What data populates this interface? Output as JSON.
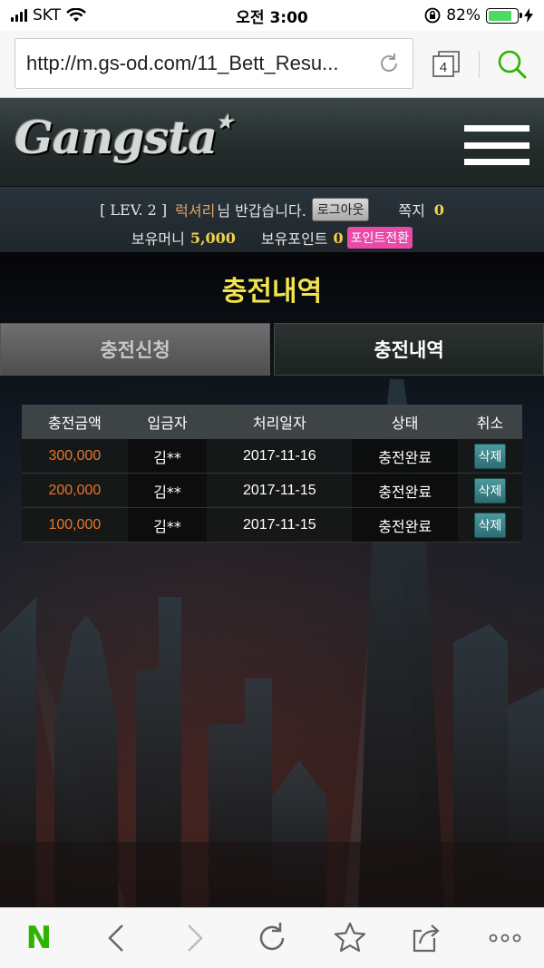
{
  "status_bar": {
    "carrier": "SKT",
    "time": "오전 3:00",
    "battery": "82%",
    "battery_level": 0.82
  },
  "browser": {
    "url": "http://m.gs-od.com/11_Bett_Resu...",
    "tab_count": "4"
  },
  "site": {
    "logo": "Gangsta",
    "logo_star": "★"
  },
  "user": {
    "level": "[ LEV. 2 ]",
    "nickname": "럭셔리",
    "greeting": "님 반갑습니다.",
    "logout_label": "로그아웃",
    "message_label": "쪽지",
    "message_count": "0",
    "money_label": "보유머니",
    "money_value": "5,000",
    "points_label": "보유포인트",
    "points_value": "0",
    "convert_label": "포인트전환"
  },
  "page": {
    "title": "충전내역",
    "tabs": [
      {
        "label": "충전신청",
        "active": false
      },
      {
        "label": "충전내역",
        "active": true
      }
    ]
  },
  "table": {
    "headers": [
      "충전금액",
      "입금자",
      "처리일자",
      "상태",
      "취소"
    ],
    "rows": [
      {
        "amount": "300,000",
        "depositor": "김**",
        "date": "2017-11-16",
        "status": "충전완료",
        "action": "삭제"
      },
      {
        "amount": "200,000",
        "depositor": "김**",
        "date": "2017-11-15",
        "status": "충전완료",
        "action": "삭제"
      },
      {
        "amount": "100,000",
        "depositor": "김**",
        "date": "2017-11-15",
        "status": "충전완료",
        "action": "삭제"
      }
    ]
  },
  "bottom_bar": {
    "n_logo": "N",
    "icons": [
      "naver-n-icon",
      "back-icon",
      "forward-icon",
      "reload-icon",
      "bookmark-star-icon",
      "share-icon",
      "more-icon"
    ]
  },
  "colors": {
    "title_yellow": "#f3e34b",
    "amount_orange": "#e6752c",
    "point_pink": "#e94aa7",
    "delete_teal": "#3a8a90",
    "naver_green": "#2db400"
  }
}
